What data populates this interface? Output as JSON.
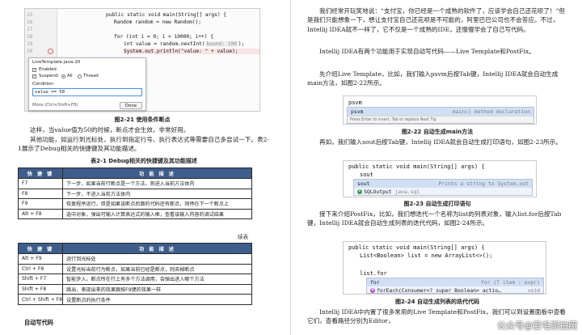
{
  "left": {
    "fig21_code": {
      "line_numbers": [
        "15",
        "16",
        "17",
        "18",
        "19",
        "20"
      ],
      "line1": "public static void main(String[] args) {",
      "line2": "Random random = new Random();",
      "line3": "for (int i = 0; i < 10000; i++) {",
      "line4_a": "int value = random.nextInt(",
      "line4_hint": "bound: 100",
      "line4_b": ");",
      "line5": "System.out.println(\"value: \" + value);"
    },
    "popup": {
      "title": "LiveTemplate.java:20",
      "enabled": "Enabled",
      "suspend": "Suspend:",
      "all": "All",
      "thread": "Thread",
      "condition_label": "Condition:",
      "condition_value": "value == 50",
      "more": "More (Ctrl+Shift+F8)",
      "done": "Done"
    },
    "fig21_caption": "图2-21  使用条件断点",
    "para1": "这样，当value值为50的时候，断点才会生效，非常好用。",
    "para2": "其他功能，如运行到光标处、执行到指定行号、执行表达式等需要自己多尝试一下。表2-1展示了Debug相关的快捷键及其功能描述。",
    "table_caption": "表2-1  Debug相关的快捷键及其功能描述",
    "table_headers": [
      "快 捷 键",
      "功 能 描 述"
    ],
    "table1_rows": [
      [
        "F7",
        "下一步，如果当前行断点是一个方法，则进入当前方法体内"
      ],
      [
        "F8",
        "下一步，不进入当前方法体内"
      ],
      [
        "F9",
        "恢复程序运行，但是如果该断点后面的代码还有断点，则停在下一个断点上"
      ],
      [
        "Alt + F8",
        "选中对象，弹出可输入计算表达式的输入框，查看该输入内容的调试结果"
      ]
    ],
    "continued": "续表",
    "table2_rows": [
      [
        "Alt + F9",
        "运行到光标处"
      ],
      [
        "Ctrl + F8",
        "设置光标当前行为断点，如果当前已经是断点，则去掉断点"
      ],
      [
        "Shift + F7",
        "智能步入，断点所在行上有多个方法调用，会弹出进入哪个方法"
      ],
      [
        "Shift + F8",
        "跳出，表现出来的效果跟按F9键的效果一样"
      ],
      [
        "Ctrl + Shift + F8",
        "设置断点的执行条件"
      ]
    ],
    "section_title": "自动写代码"
  },
  "right": {
    "para1": "我们经常开玩笑地说：“支付宝，你已经是一个成熟的软件了，应该学会自己还花呗了！”但是我们只能想象一下，想让支付宝自己还花呗是不可能的，阿里巴巴公司也不会答应。不过，Intellij IDEA就不一样了，它不仅是一个成熟的IDE，还慢慢学会了自己写代码。",
    "para2": "Intellij IDEA有两个功能用于实现自动写代码——Live Template和PostFix。",
    "para3": "先介绍Live Template，比如，我们输入psvm后按Tab键，Intellij IDEA就会自动生成main方法，如图2-22所示。",
    "fig22": {
      "typed": "psvm",
      "item": "psvm",
      "item_desc": "main() method declaration",
      "footer": "Press Enter to insert, Tab to replace  Next Tip"
    },
    "fig22_caption": "图2-22  自动生成main方法",
    "para4": "再如，我们输入sout后按Tab键，Intellij IDEA就会自动生成打印语句，如图2-23所示。",
    "fig23": {
      "line1": "public static void main(String[] args) {",
      "typed": "sout",
      "item1": "sout",
      "item1_desc": "Prints a string to System.out",
      "item2_icon": "c",
      "item2": "SQLOutput",
      "item2_pkg": "java.sql"
    },
    "fig23_caption": "图2-23  自动生成打印语句",
    "para5": "接下来介绍PostFix，比如，我们想迭代一个名称为list的列表对象，输入list.for后按Tab键，Intellij IDEA就会自动生成列表的迭代代码，如图2-24所示。",
    "fig24": {
      "line1": "public static void main(String[] args) {",
      "line2": "List<Boolean> list = new ArrayList<>();",
      "line3": "list.for",
      "item1": "for",
      "item1_desc": "for (T item : expr)",
      "item2_icon": "m",
      "item2": "forEach(Consumer<? super Boolean> actio…",
      "item2_ret": "void"
    },
    "fig24_caption": "图2-24  自动生成列表的迭代代码",
    "para6": "Intellij IDEA中内置了很多常用的Live Template和PostFix，我们可以到设置面板中查看它们，查看路径分别为Editor，",
    "watermark": "公众号@爱毛斯拍照"
  },
  "colors": {
    "table_header": "#3d5d8a",
    "breakpoint": "#db5860",
    "selection": "#d1dff5"
  }
}
